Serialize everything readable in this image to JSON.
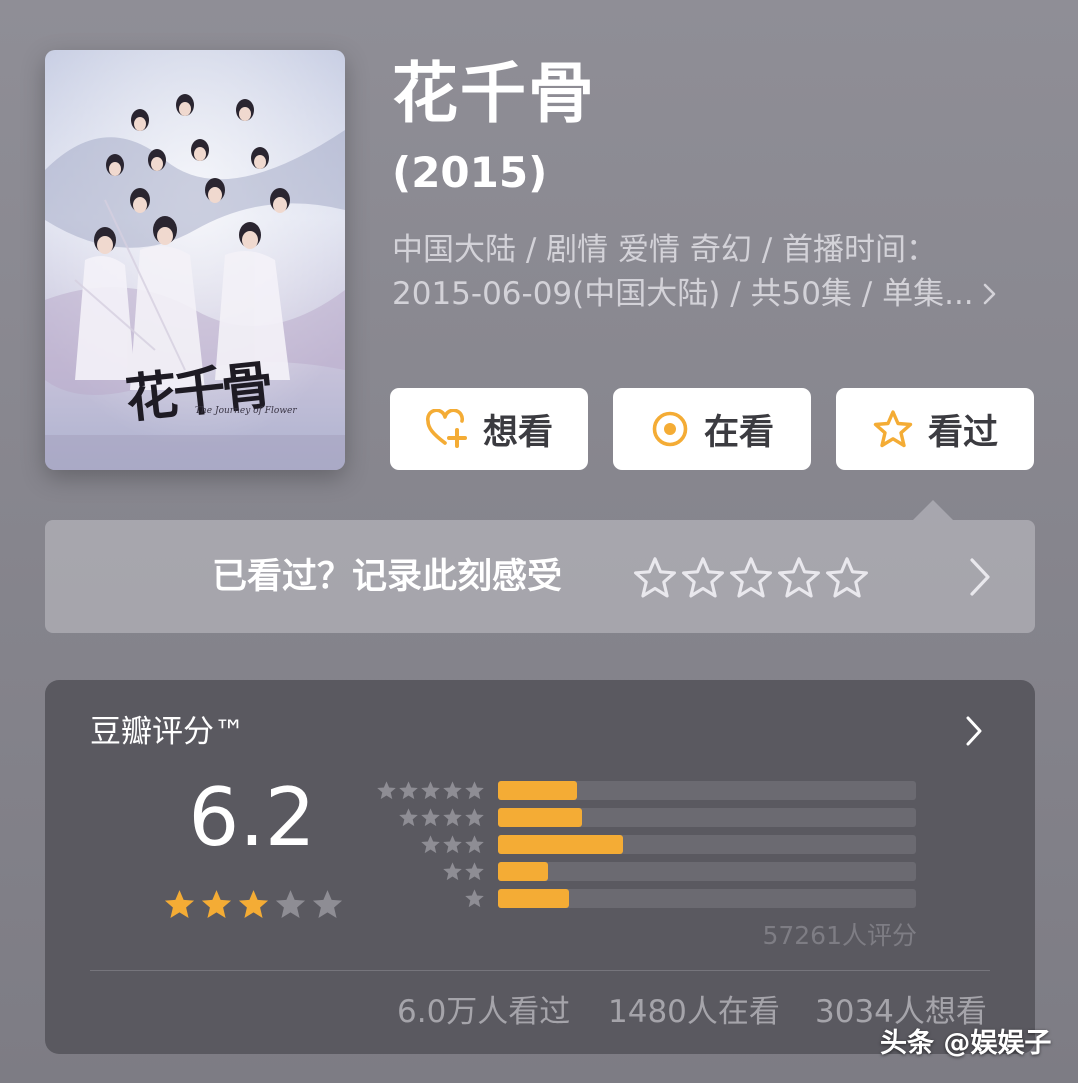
{
  "movie": {
    "title": "花千骨",
    "year": "(2015)",
    "meta_line1": "中国大陆 / 剧情 爱情 奇幻 / 首播时间：",
    "meta_line2": "2015-06-09(中国大陆) / 共50集 / 单集...",
    "poster": {
      "title_art": "花千骨",
      "subtitle_art": "The Journey of Flower"
    }
  },
  "actions": {
    "want": {
      "label": "想看",
      "icon": "heart-plus-icon"
    },
    "watching": {
      "label": "在看",
      "icon": "target-circle-icon"
    },
    "watched": {
      "label": "看过",
      "icon": "star-outline-icon"
    }
  },
  "prompt": {
    "text": "已看过？记录此刻感受",
    "stars": 5
  },
  "rating": {
    "label": "豆瓣评分™",
    "score": "6.2",
    "stars_filled": 3,
    "stars_total": 5,
    "distribution": [
      {
        "stars": 5,
        "fraction": 0.19
      },
      {
        "stars": 4,
        "fraction": 0.2
      },
      {
        "stars": 3,
        "fraction": 0.3
      },
      {
        "stars": 2,
        "fraction": 0.12
      },
      {
        "stars": 1,
        "fraction": 0.17
      }
    ],
    "count_text": "57261人评分",
    "stats": {
      "watched": "6.0万人看过",
      "watching": "1480人在看",
      "want": "3034人想看"
    }
  },
  "watermark": "头条 @娱娱子",
  "colors": {
    "accent": "#f4ac35",
    "background": "#8a8990",
    "card": "#5a5960",
    "track": "#6b6a71"
  }
}
